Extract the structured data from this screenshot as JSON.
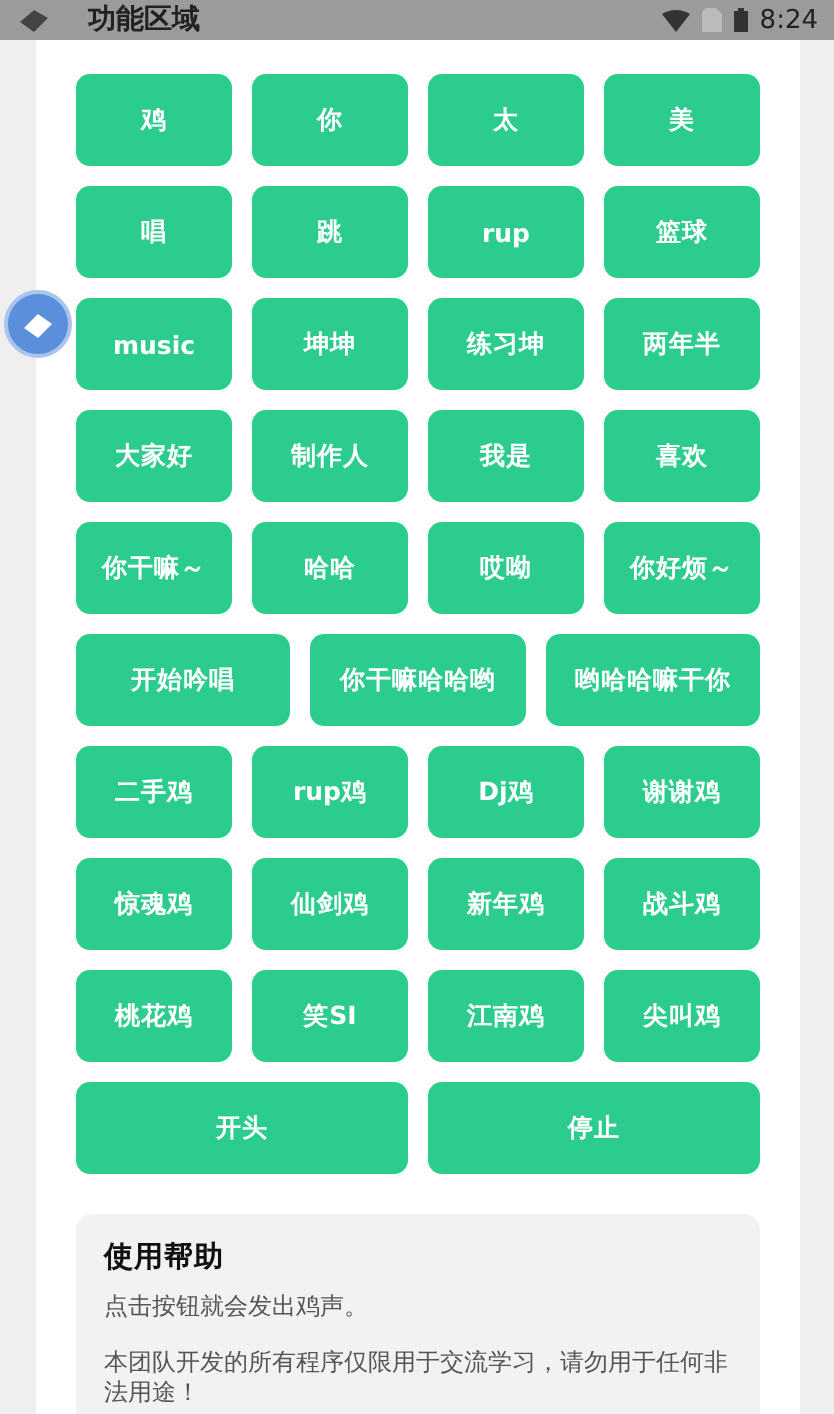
{
  "status_bar": {
    "title": "功能区域",
    "time": "8:24"
  },
  "button_rows": [
    {
      "buttons": [
        "鸡",
        "你",
        "太",
        "美"
      ]
    },
    {
      "buttons": [
        "唱",
        "跳",
        "rup",
        "篮球"
      ]
    },
    {
      "buttons": [
        "music",
        "坤坤",
        "练习坤",
        "两年半"
      ]
    },
    {
      "buttons": [
        "大家好",
        "制作人",
        "我是",
        "喜欢"
      ]
    },
    {
      "buttons": [
        "你干嘛～",
        "哈哈",
        "哎呦",
        "你好烦～"
      ]
    },
    {
      "buttons": [
        "开始吟唱",
        "你干嘛哈哈哟",
        "哟哈哈嘛干你"
      ]
    },
    {
      "buttons": [
        "二手鸡",
        "rup鸡",
        "Dj鸡",
        "谢谢鸡"
      ]
    },
    {
      "buttons": [
        "惊魂鸡",
        "仙剑鸡",
        "新年鸡",
        "战斗鸡"
      ]
    },
    {
      "buttons": [
        "桃花鸡",
        "笑SI",
        "江南鸡",
        "尖叫鸡"
      ]
    },
    {
      "buttons": [
        "开头",
        "停止"
      ]
    }
  ],
  "help": {
    "title": "使用帮助",
    "paragraphs": [
      "点击按钮就会发出鸡声。",
      "本团队开发的所有程序仅限用于交流学习，请勿用于任何非法用途！"
    ]
  }
}
